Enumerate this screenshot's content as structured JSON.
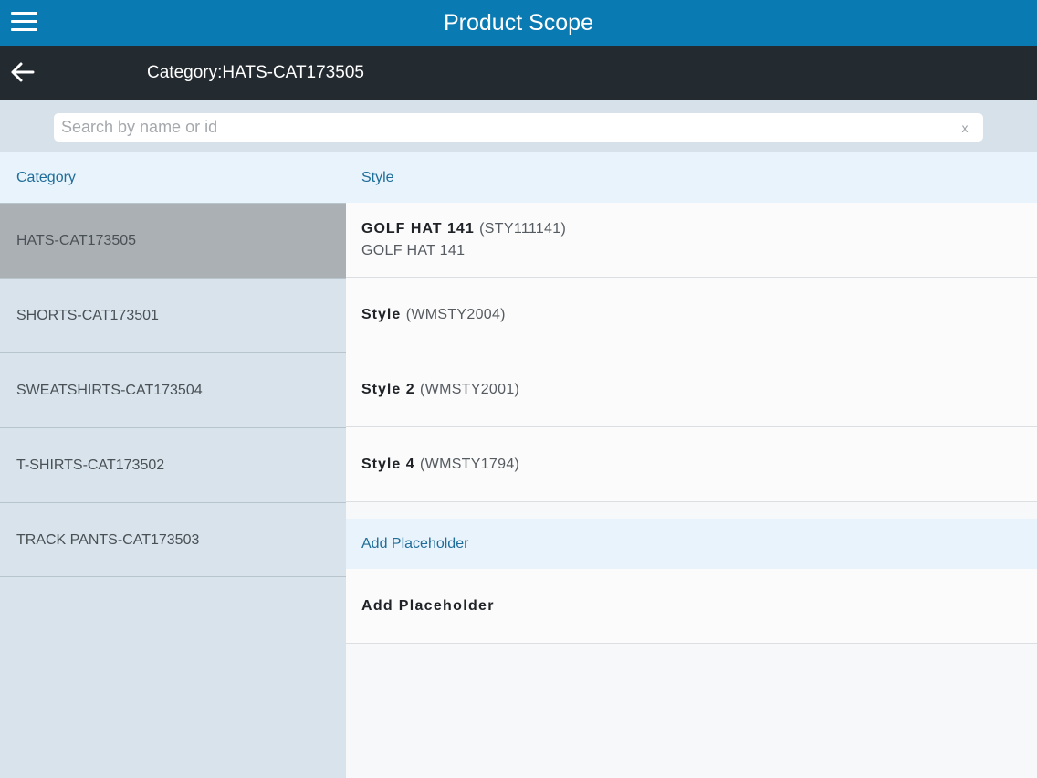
{
  "header": {
    "title": "Product Scope",
    "menu_icon": "hamburger-menu-icon"
  },
  "subheader": {
    "title": "Category:HATS-CAT173505",
    "back_icon": "back-arrow-icon"
  },
  "search": {
    "placeholder": "Search by name or id",
    "value": "",
    "clear_label": "x"
  },
  "categories": {
    "header": "Category",
    "items": [
      {
        "label": "HATS-CAT173505",
        "selected": true
      },
      {
        "label": "SHORTS-CAT173501"
      },
      {
        "label": "SWEATSHIRTS-CAT173504"
      },
      {
        "label": "T-SHIRTS-CAT173502"
      },
      {
        "label": "TRACK PANTS-CAT173503"
      }
    ]
  },
  "styles": {
    "header": "Style",
    "items": [
      {
        "name": "GOLF HAT 141",
        "id": "(STY111141)",
        "subtitle": "GOLF HAT 141"
      },
      {
        "name": "Style",
        "id": "(WMSTY2004)"
      },
      {
        "name": "Style 2",
        "id": "(WMSTY2001)"
      },
      {
        "name": "Style 4",
        "id": "(WMSTY1794)"
      }
    ]
  },
  "placeholder": {
    "header": "Add Placeholder",
    "item_label": "Add Placeholder"
  },
  "colors": {
    "topbar": "#0a7ab2",
    "subbar": "#232a30",
    "accent_text": "#1f6d99",
    "selected_row": "#abb0b4"
  }
}
